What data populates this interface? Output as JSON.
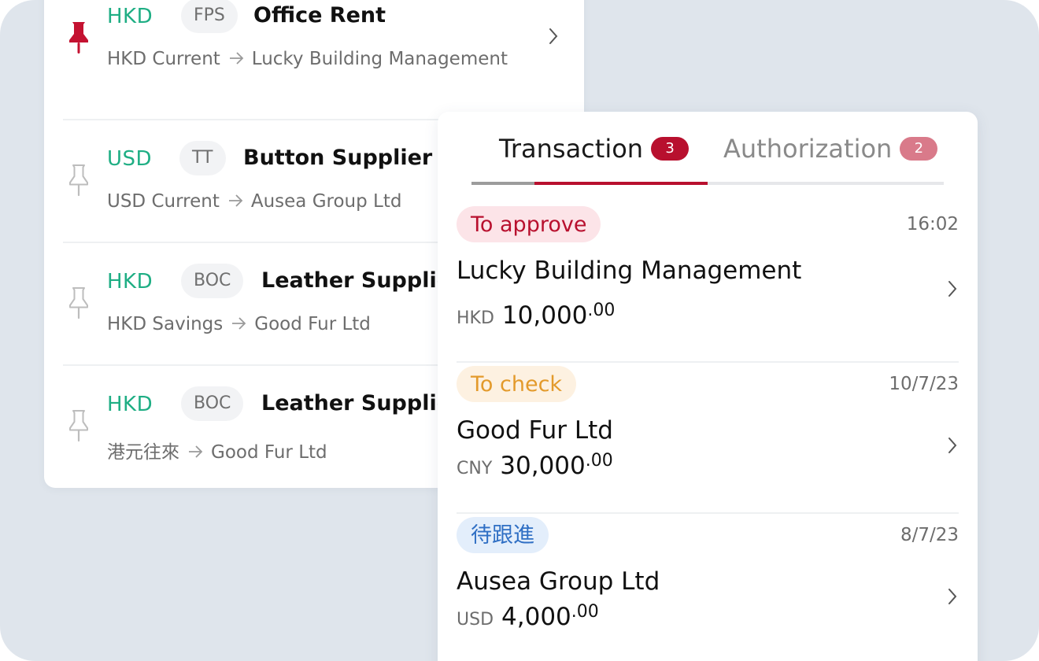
{
  "colors": {
    "brand_red": "#b8102e",
    "currency_green": "#1fae84",
    "pin_active": "#c41231",
    "pin_inactive": "#bdbdbd"
  },
  "payees": [
    {
      "currency": "HKD",
      "method": "FPS",
      "name": "Office Rent",
      "from_account": "HKD Current",
      "to_account": "Lucky Building Management",
      "pinned": true,
      "pin_icon": "pushpin-filled-icon"
    },
    {
      "currency": "USD",
      "method": "TT",
      "name": "Button Supplier",
      "from_account": "USD Current",
      "to_account": "Ausea Group Ltd",
      "pinned": false,
      "pin_icon": "pushpin-outline-icon"
    },
    {
      "currency": "HKD",
      "method": "BOC",
      "name": "Leather Supplier",
      "from_account": "HKD Savings",
      "to_account": "Good Fur Ltd",
      "pinned": false,
      "pin_icon": "pushpin-outline-icon"
    },
    {
      "currency": "HKD",
      "method": "BOC",
      "name": "Leather Supplier",
      "from_account": "港元往來",
      "to_account": "Good Fur Ltd",
      "pinned": false,
      "pin_icon": "pushpin-outline-icon"
    }
  ],
  "tabs": [
    {
      "label": "Transaction",
      "badge": "3",
      "active": true,
      "badge_color": "#b8102e",
      "text_color": "#1a1a1a"
    },
    {
      "label": "Authorization",
      "badge": "2",
      "active": false,
      "badge_color": "#d97a8a",
      "text_color": "#8a8a8a"
    }
  ],
  "transactions": [
    {
      "status": "To approve",
      "status_bg": "#fce4e8",
      "status_fg": "#b8102e",
      "date": "16:02",
      "name": "Lucky Building Management",
      "currency": "HKD",
      "amount_int": "10,000",
      "amount_dec": ".00"
    },
    {
      "status": "To check",
      "status_bg": "#fdf1e1",
      "status_fg": "#e39a2b",
      "date": "10/7/23",
      "name": "Good Fur Ltd",
      "currency": "CNY",
      "amount_int": "30,000",
      "amount_dec": ".00"
    },
    {
      "status": "待跟進",
      "status_bg": "#e3eefb",
      "status_fg": "#2f6fc4",
      "date": "8/7/23",
      "name": "Ausea Group Ltd",
      "currency": "USD",
      "amount_int": "4,000",
      "amount_dec": ".00"
    }
  ],
  "icons": {
    "chevron": "chevron-right-icon",
    "arrow": "arrow-right-icon"
  }
}
